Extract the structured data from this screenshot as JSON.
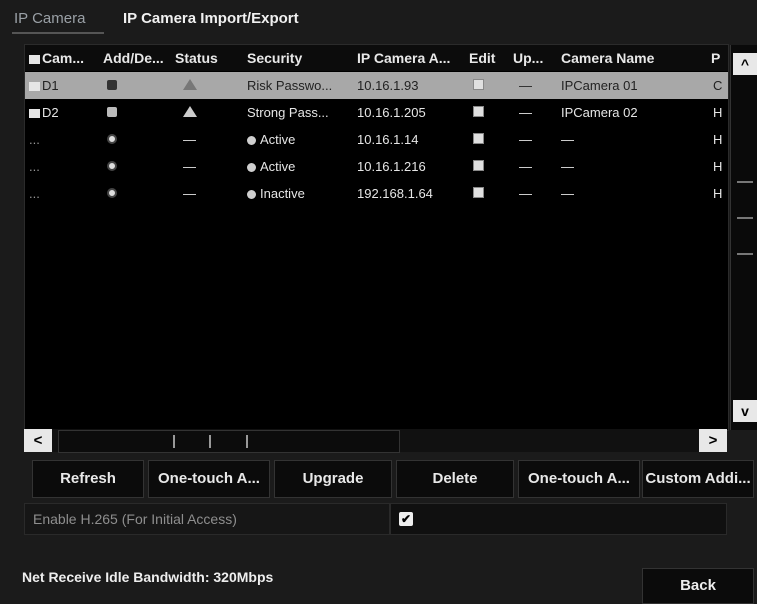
{
  "tabs": [
    {
      "label": "IP Camera"
    },
    {
      "label": "IP Camera Import/Export"
    }
  ],
  "table": {
    "headers": [
      "Cam...",
      "Add/De...",
      "Status",
      "Security",
      "IP Camera A...",
      "Edit",
      "Up...",
      "Camera Name",
      "P"
    ],
    "rows": [
      {
        "cam": "D1",
        "add": "delete-icon",
        "status": "warning-icon",
        "security": "Risk Passwo...",
        "ip": "10.16.1.93",
        "edit": "edit-icon",
        "upgrade": "—",
        "name": "IPCamera 01",
        "p": "C",
        "selected": true
      },
      {
        "cam": "D2",
        "add": "delete-icon",
        "status": "warning-icon",
        "security": "Strong Pass...",
        "ip": "10.16.1.205",
        "edit": "edit-icon",
        "upgrade": "—",
        "name": "IPCamera 02",
        "p": "H",
        "selected": false
      },
      {
        "cam": "...",
        "add": "add-icon",
        "status": "—",
        "security": "Active",
        "ip": "10.16.1.14",
        "edit": "edit-icon",
        "upgrade": "—",
        "name": "—",
        "p": "H",
        "selected": false
      },
      {
        "cam": "...",
        "add": "add-icon",
        "status": "—",
        "security": "Active",
        "ip": "10.16.1.216",
        "edit": "edit-icon",
        "upgrade": "—",
        "name": "—",
        "p": "H",
        "selected": false
      },
      {
        "cam": "...",
        "add": "add-icon",
        "status": "—",
        "security": "Inactive",
        "ip": "192.168.1.64",
        "edit": "edit-icon",
        "upgrade": "—",
        "name": "—",
        "p": "H",
        "selected": false
      }
    ]
  },
  "scroll": {
    "up": "^",
    "down": "v",
    "left": "<",
    "right": ">"
  },
  "buttons": [
    "Refresh",
    "One-touch A...",
    "Upgrade",
    "Delete",
    "One-touch A...",
    "Custom Addi..."
  ],
  "option": {
    "label": "Enable H.265 (For Initial Access)",
    "checked": "✔"
  },
  "footer": {
    "bandwidth": "Net Receive Idle Bandwidth: 320Mbps",
    "back": "Back"
  }
}
